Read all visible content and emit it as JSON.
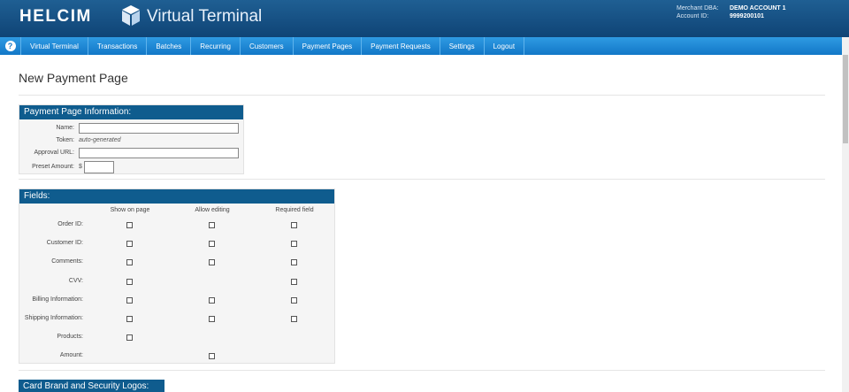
{
  "header": {
    "logo": "HELCIM",
    "product": "Virtual Terminal",
    "merchant_dba_label": "Merchant DBA:",
    "merchant_dba_value": "DEMO ACCOUNT 1",
    "account_id_label": "Account ID:",
    "account_id_value": "9999200101"
  },
  "nav": {
    "help_icon": "help-icon",
    "items": [
      "Virtual Terminal",
      "Transactions",
      "Batches",
      "Recurring",
      "Customers",
      "Payment Pages",
      "Payment Requests",
      "Settings",
      "Logout"
    ]
  },
  "page": {
    "title": "New Payment Page"
  },
  "info_panel": {
    "heading": "Payment Page Information:",
    "name_label": "Name:",
    "token_label": "Token:",
    "token_value": "auto-generated",
    "approval_url_label": "Approval URL:",
    "preset_amount_label": "Preset Amount:",
    "currency_symbol": "$"
  },
  "fields_panel": {
    "heading": "Fields:",
    "columns": [
      "Show on page",
      "Allow editing",
      "Required field"
    ],
    "rows": [
      {
        "label": "Order ID:",
        "show": true,
        "edit": true,
        "req": true
      },
      {
        "label": "Customer ID:",
        "show": true,
        "edit": true,
        "req": true
      },
      {
        "label": "Comments:",
        "show": true,
        "edit": true,
        "req": true
      },
      {
        "label": "CVV:",
        "show": true,
        "edit": false,
        "req": true
      },
      {
        "label": "Billing Information:",
        "show": true,
        "edit": true,
        "req": true
      },
      {
        "label": "Shipping Information:",
        "show": true,
        "edit": true,
        "req": true
      },
      {
        "label": "Products:",
        "show": true,
        "edit": false,
        "req": false
      },
      {
        "label": "Amount:",
        "show": false,
        "edit": true,
        "req": false
      }
    ]
  },
  "logos_panel": {
    "heading": "Card Brand and Security Logos:"
  }
}
